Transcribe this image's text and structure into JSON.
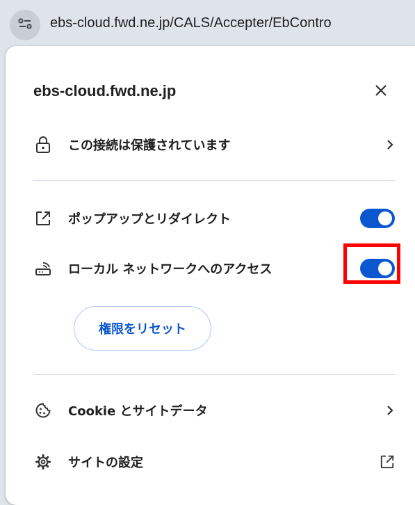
{
  "omnibox": {
    "url": "ebs-cloud.fwd.ne.jp/CALS/Accepter/EbContro",
    "site_info_icon": "tune-icon"
  },
  "popup": {
    "title": "ebs-cloud.fwd.ne.jp",
    "close_icon": "close-icon",
    "connection": {
      "label": "この接続は保護されています",
      "icon": "lock-icon"
    },
    "permissions": [
      {
        "label": "ポップアップとリダイレクト",
        "icon": "open-in-new-icon",
        "enabled": true
      },
      {
        "label": "ローカル ネットワークへのアクセス",
        "icon": "local-network-icon",
        "enabled": true
      }
    ],
    "reset_button": "権限をリセット",
    "cookies": {
      "label": "Cookie とサイトデータ",
      "icon": "cookie-icon"
    },
    "site_settings": {
      "label": "サイトの設定",
      "icon": "gear-icon"
    }
  },
  "colors": {
    "toggle_on": "#0b57d0",
    "highlight": "#ff0000",
    "button_text": "#0b57d0"
  }
}
